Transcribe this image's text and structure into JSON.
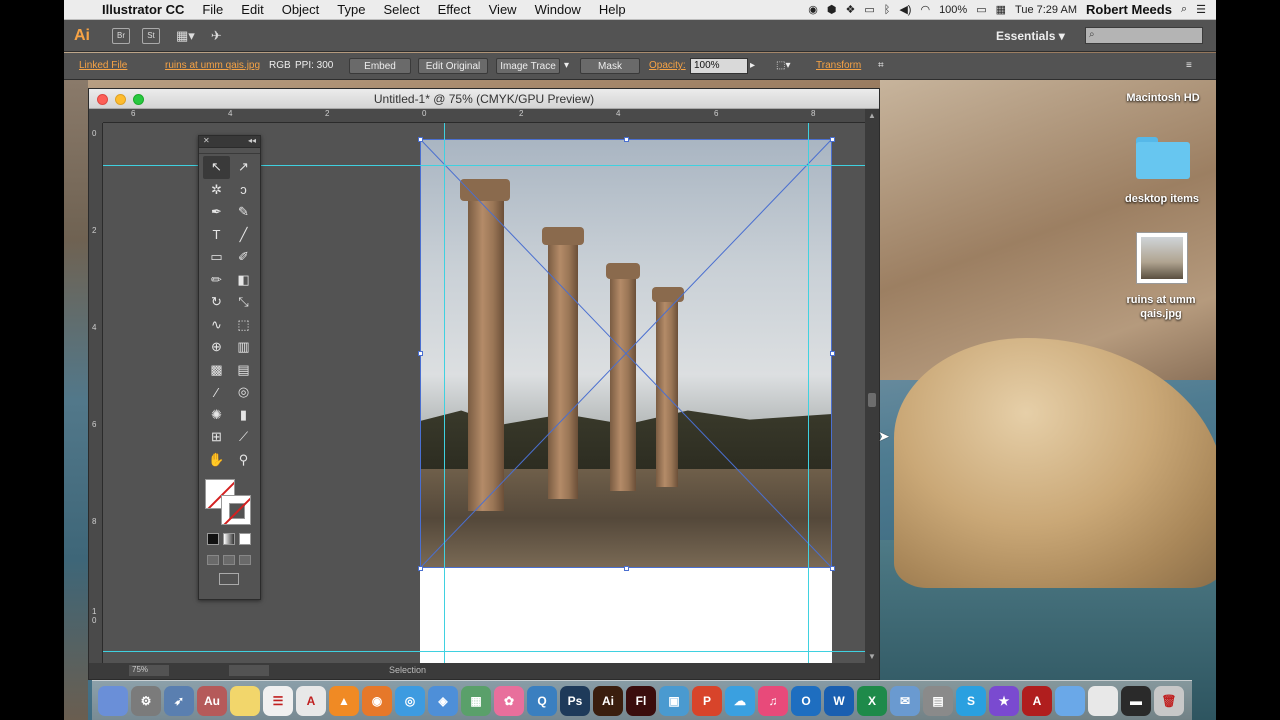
{
  "menubar": {
    "app_name": "Illustrator CC",
    "menus": [
      "File",
      "Edit",
      "Object",
      "Type",
      "Select",
      "Effect",
      "View",
      "Window",
      "Help"
    ],
    "battery": "100%",
    "clock": "Tue 7:29 AM",
    "user": "Robert Meeds"
  },
  "appbar": {
    "logo": "Ai",
    "bridge": "Br",
    "stock": "St",
    "workspace": "Essentials"
  },
  "controlbar": {
    "linked_file": "Linked File",
    "file_name": "ruins at umm qais.jpg",
    "color_mode": "RGB",
    "ppi": "PPI: 300",
    "embed": "Embed",
    "edit_original": "Edit Original",
    "image_trace": "Image Trace",
    "mask": "Mask",
    "opacity_label": "Opacity:",
    "opacity_value": "100%",
    "transform": "Transform"
  },
  "document": {
    "title": "Untitled-1* @ 75% (CMYK/GPU Preview)",
    "zoom": "75%",
    "status": "Selection",
    "ruler_h_labels": [
      "6",
      "4",
      "2",
      "0",
      "2",
      "4",
      "6",
      "8"
    ],
    "ruler_v_labels": [
      "0",
      "2",
      "4",
      "6",
      "8",
      "1 0"
    ]
  },
  "desktop": {
    "drive": "Macintosh HD",
    "folder": "desktop items",
    "file": "ruins at umm qais.jpg"
  },
  "dock": {
    "apps": [
      {
        "label": "",
        "color": "#6a8fd8"
      },
      {
        "label": "⚙",
        "color": "#7b7b7b"
      },
      {
        "label": "➶",
        "color": "#5a7fb0"
      },
      {
        "label": "Au",
        "color": "#b55a5a"
      },
      {
        "label": "",
        "color": "#f2d66b"
      },
      {
        "label": "☰",
        "color": "#f0f0f0"
      },
      {
        "label": "A",
        "color": "#e8e8e8"
      },
      {
        "label": "▲",
        "color": "#f08a24"
      },
      {
        "label": "◉",
        "color": "#e6782a"
      },
      {
        "label": "◎",
        "color": "#3d9be0"
      },
      {
        "label": "◈",
        "color": "#4e8fd8"
      },
      {
        "label": "▦",
        "color": "#5aa06a"
      },
      {
        "label": "✿",
        "color": "#e86f9c"
      },
      {
        "label": "Q",
        "color": "#3a7fc0"
      },
      {
        "label": "Ps",
        "color": "#1e3a5a"
      },
      {
        "label": "Ai",
        "color": "#3a1e0e"
      },
      {
        "label": "Fl",
        "color": "#3a0d0d"
      },
      {
        "label": "▣",
        "color": "#4a9ad0"
      },
      {
        "label": "P",
        "color": "#d8442a"
      },
      {
        "label": "☁",
        "color": "#3aa0e0"
      },
      {
        "label": "♫",
        "color": "#e84a7a"
      },
      {
        "label": "O",
        "color": "#1e6ec0"
      },
      {
        "label": "W",
        "color": "#1a5fb0"
      },
      {
        "label": "X",
        "color": "#1e8a4a"
      },
      {
        "label": "✉",
        "color": "#6a9ad0"
      },
      {
        "label": "▤",
        "color": "#8a8a8a"
      },
      {
        "label": "S",
        "color": "#2aa0e0"
      },
      {
        "label": "★",
        "color": "#7a4ad0"
      },
      {
        "label": "A",
        "color": "#b01e1e"
      },
      {
        "label": "",
        "color": "#6aa8e8"
      },
      {
        "label": "",
        "color": "#e8e8e8"
      },
      {
        "label": "▬",
        "color": "#2a2a2a"
      },
      {
        "label": "🗑",
        "color": "#c8c8c8"
      }
    ]
  }
}
